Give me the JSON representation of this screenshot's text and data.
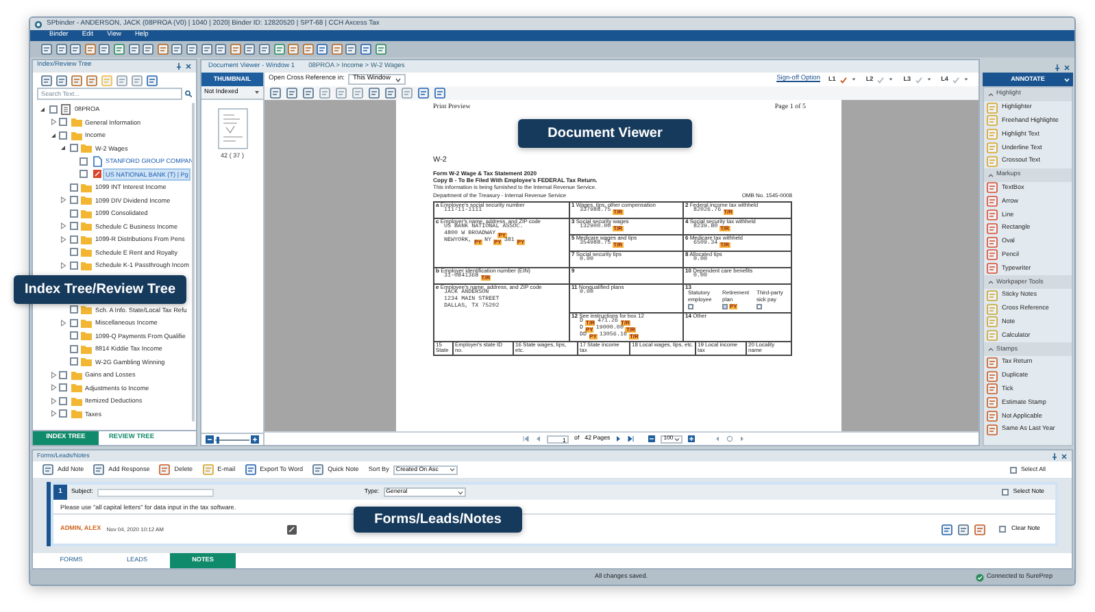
{
  "window": {
    "title": "SPbinder - ANDERSON, JACK (08PROA (V0) | 1040 | 2020| Binder ID: 12820520 | SPT-68 | CCH Axcess Tax"
  },
  "menu": [
    "Binder",
    "Edit",
    "View",
    "Help"
  ],
  "index_panel": {
    "title": "Index/Review Tree",
    "search": {
      "placeholder": "Search Text..."
    },
    "tree": [
      {
        "label": "08PROA",
        "kind": "binder",
        "expanded": true,
        "checked": false,
        "selected": false,
        "children": [
          {
            "label": "General Information",
            "kind": "folder",
            "expanded": false,
            "checked": false,
            "selected": false
          },
          {
            "label": "Income",
            "kind": "folder",
            "expanded": true,
            "checked": false,
            "selected": false,
            "children": [
              {
                "label": "W-2 Wages",
                "kind": "folder",
                "expanded": true,
                "checked": false,
                "selected": false,
                "children": [
                  {
                    "label": "STANFORD GROUP COMPAN",
                    "kind": "document",
                    "checked": false,
                    "selected": false
                  },
                  {
                    "label": "US NATIONAL BANK (T) | Pg",
                    "kind": "pdf",
                    "checked": false,
                    "selected": true
                  }
                ]
              },
              {
                "label": "1099 INT Interest Income",
                "kind": "folder",
                "checked": false,
                "selected": false
              },
              {
                "label": "1099 DIV Dividend Income",
                "kind": "folder",
                "expanded": false,
                "checked": false,
                "selected": false
              },
              {
                "label": "1099 Consolidated",
                "kind": "folder",
                "checked": false,
                "selected": false
              },
              {
                "label": "Schedule C Business Income",
                "kind": "folder",
                "expanded": false,
                "checked": false,
                "selected": false
              },
              {
                "label": "1099-R  Distributions From Pens",
                "kind": "folder",
                "expanded": false,
                "checked": false,
                "selected": false
              },
              {
                "label": "Schedule E  Rent and Royalty",
                "kind": "folder",
                "checked": false,
                "selected": false
              },
              {
                "label": "Schedule K-1 Passthrough Incom",
                "kind": "folder",
                "expanded": false,
                "checked": false,
                "selected": false
              },
              {
                "label": "Sch. A Info. State/Local Tax Refu",
                "kind": "folder",
                "checked": false,
                "selected": false
              },
              {
                "label": "Miscellaneous Income",
                "kind": "folder",
                "expanded": false,
                "checked": false,
                "selected": false
              },
              {
                "label": "1099-Q Payments From Qualifie",
                "kind": "folder",
                "checked": false,
                "selected": false
              },
              {
                "label": "8814 Kiddie Tax Income",
                "kind": "folder",
                "checked": false,
                "selected": false
              },
              {
                "label": "W-2G Gambling Winning",
                "kind": "folder",
                "checked": false,
                "selected": false
              }
            ]
          },
          {
            "label": "Gains and Losses",
            "kind": "folder",
            "expanded": false,
            "checked": false,
            "selected": false
          },
          {
            "label": "Adjustments to Income",
            "kind": "folder",
            "expanded": false,
            "checked": false,
            "selected": false
          },
          {
            "label": "Itemized Deductions",
            "kind": "folder",
            "expanded": false,
            "checked": false,
            "selected": false
          },
          {
            "label": "Taxes",
            "kind": "folder",
            "expanded": false,
            "checked": false,
            "selected": false
          }
        ]
      }
    ],
    "tabs": [
      {
        "label": "INDEX TREE",
        "selected": true
      },
      {
        "label": "REVIEW TREE",
        "selected": false
      }
    ]
  },
  "thumbnail_panel": {
    "tab": "THUMBNAIL",
    "filter": "Not Indexed",
    "caption": "42 ( 37 )",
    "zoom": {
      "level": 0.05
    }
  },
  "document_viewer": {
    "title": "Document Viewer - Window 1",
    "breadcrumb": "08PROA > Income > W-2 Wages",
    "cross_reference_label": "Open Cross Reference in:",
    "cross_reference_value": "This Window",
    "signoff_link": "Sign-off Option",
    "signoff_levels": [
      {
        "label": "L1",
        "checked": true
      },
      {
        "label": "L2",
        "checked": false
      },
      {
        "label": "L3",
        "checked": false
      },
      {
        "label": "L4",
        "checked": false
      }
    ],
    "page": {
      "header_left": "Print Preview",
      "header_right": "Page 1 of 5",
      "form_code": "W-2",
      "form_title": "Form W-2 Wage & Tax Statement 2020",
      "copy_line": "Copy B - To Be Filed With Employee's FEDERAL Tax Return.",
      "info_line": "This information is being furnished to the Internal Revenue Service.",
      "department": "Department of the Treasury - Internal Revenue Service",
      "omb": "OMB No. 1545-0008",
      "left_column": [
        {
          "label": "**a** Employee's social security number",
          "lines": [
            [
              {
                "kind": "text",
                "text": "111-11-1111"
              }
            ]
          ]
        },
        {
          "label": "**c** Employer's name, address, and ZIP code",
          "lines": [
            [
              {
                "kind": "text",
                "text": "US BANK NATIONAL ASSOC."
              }
            ],
            [
              {
                "kind": "text",
                "text": "4800 W BROADWAY"
              },
              {
                "kind": "tag",
                "text": "PY"
              }
            ],
            [
              {
                "kind": "text",
                "text": "NEWYORK,"
              },
              {
                "kind": "tag",
                "text": "PY"
              },
              {
                "kind": "text",
                "text": "NY"
              },
              {
                "kind": "tag",
                "text": "PY"
              },
              {
                "kind": "text",
                "text": "381"
              },
              {
                "kind": "tag",
                "text": "PY"
              }
            ]
          ]
        },
        {
          "label": "**b** Employer identification number (EIN)",
          "lines": [
            [
              {
                "kind": "text",
                "text": "31-0841368"
              },
              {
                "kind": "tag",
                "text": "T/R"
              }
            ]
          ]
        },
        {
          "label": "**e** Employee's name, address, and ZIP code",
          "lines": [
            [
              {
                "kind": "text",
                "text": "JACK ANDERSON"
              }
            ],
            [
              {
                "kind": "text",
                "text": "1234 MAIN STREET"
              }
            ],
            [
              {
                "kind": "text",
                "text": "DALLAS, TX 75202"
              }
            ]
          ]
        }
      ],
      "middle_column": [
        {
          "label": "**1** Wages, tips, other compensation",
          "lines": [
            [
              {
                "kind": "text",
                "text": "337988.75"
              },
              {
                "kind": "tag",
                "text": "T/R"
              }
            ]
          ]
        },
        {
          "label": "**3** Social security wages",
          "lines": [
            [
              {
                "kind": "text",
                "text": "132900.00"
              },
              {
                "kind": "tag",
                "text": "T/R"
              }
            ]
          ]
        },
        {
          "label": "**5** Medicare wages and tips",
          "lines": [
            [
              {
                "kind": "text",
                "text": "354988.75"
              },
              {
                "kind": "tag",
                "text": "T/R"
              }
            ]
          ]
        },
        {
          "label": "**7** Social security tips",
          "lines": [
            [
              {
                "kind": "text",
                "text": "0.00"
              }
            ]
          ]
        },
        {
          "label": "**9**"
        },
        {
          "label": "**11** Nonqualified plans",
          "lines": [
            [
              {
                "kind": "text",
                "text": "0.00"
              }
            ]
          ]
        },
        {
          "label": "**12** See instructions for box 12",
          "lines": [
            [
              {
                "kind": "text",
                "text": "D"
              },
              {
                "kind": "tag",
                "text": "T/R"
              },
              {
                "kind": "text",
                "text": "471.26"
              },
              {
                "kind": "tag",
                "text": "T/R"
              }
            ],
            [
              {
                "kind": "text",
                "text": "D"
              },
              {
                "kind": "tag",
                "text": "PY"
              },
              {
                "kind": "text",
                "text": "19000.00"
              },
              {
                "kind": "tag",
                "text": "T/R"
              }
            ],
            [
              {
                "kind": "text",
                "text": "DD"
              },
              {
                "kind": "tag",
                "text": "PY"
              },
              {
                "kind": "text",
                "text": "13056.16"
              },
              {
                "kind": "tag",
                "text": "T/R"
              }
            ]
          ]
        }
      ],
      "right_column": [
        {
          "label": "**2** Federal income tax withheld",
          "lines": [
            [
              {
                "kind": "text",
                "text": "82026.76"
              },
              {
                "kind": "tag",
                "text": "T/R"
              }
            ]
          ]
        },
        {
          "label": "**4** Social security tax withheld",
          "lines": [
            [
              {
                "kind": "text",
                "text": "8239.80"
              },
              {
                "kind": "tag",
                "text": "T/R"
              }
            ]
          ]
        },
        {
          "label": "**6** Medicare tax withheld",
          "lines": [
            [
              {
                "kind": "text",
                "text": "6509.34"
              },
              {
                "kind": "tag",
                "text": "T/R"
              }
            ]
          ]
        },
        {
          "label": "**8** Allocated tips",
          "lines": [
            [
              {
                "kind": "text",
                "text": "0.00"
              }
            ]
          ]
        },
        {
          "label": "**10** Dependent care benefits",
          "lines": [
            [
              {
                "kind": "text",
                "text": "0.00"
              }
            ]
          ]
        },
        {
          "label": "**13**",
          "checks": [
            {
              "label": "Statutory employee",
              "checked": false
            },
            {
              "label": "Retirement plan",
              "checked": true,
              "tag": "PY"
            },
            {
              "label": "Third-party sick pay",
              "checked": false
            }
          ]
        },
        {
          "label": "**14** Other"
        }
      ],
      "state_row": [
        "15  State",
        "Employer's state ID no.",
        "16 State wages, tips, etc.",
        "17 State income tax",
        "18 Local wages, tips, etc.",
        "19 Local income tax",
        "20 Locality name"
      ]
    },
    "pager": {
      "page": "1",
      "of_label": "of",
      "total": "42 Pages",
      "zoom": "100"
    }
  },
  "annotate_panel": {
    "title": "ANNOTATE",
    "sections": [
      {
        "title": "Highlight",
        "items": [
          "Highlighter",
          "Freehand Highlighte",
          "Highlight Text",
          "Underline Text",
          "Crossout Text"
        ]
      },
      {
        "title": "Markups",
        "items": [
          "TextBox",
          "Arrow",
          "Line",
          "Rectangle",
          "Oval",
          "Pencil",
          "Typewriter"
        ]
      },
      {
        "title": "Workpaper Tools",
        "items": [
          "Sticky Notes",
          "Cross Reference",
          "Note",
          "Calculator"
        ]
      },
      {
        "title": "Stamps",
        "items": [
          "Tax Return",
          "Duplicate",
          "Tick",
          "Estimate Stamp",
          "Not Applicable",
          "Same As Last Year"
        ]
      }
    ]
  },
  "notes_panel": {
    "title": "Forms/Leads/Notes",
    "toolbar": [
      "Add Note",
      "Add Response",
      "Delete",
      "E-mail",
      "Export To Word",
      "Quick Note"
    ],
    "sort_label": "Sort By",
    "sort_value": "Created On Asc",
    "select_all": {
      "label": "Select All",
      "checked": false
    },
    "notes": [
      {
        "number": "1",
        "subject_label": "Subject:",
        "type_label": "Type:",
        "type_value": "General",
        "select": {
          "label": "Select Note",
          "checked": false
        },
        "text": "Please use \"all capital letters\" for data input in the tax software.",
        "author": "ADMIN, ALEX",
        "timestamp": "Nov 04, 2020 10:12 AM",
        "clear": {
          "label": "Clear Note",
          "checked": false
        }
      }
    ],
    "tabs": [
      {
        "label": "FORMS",
        "selected": false
      },
      {
        "label": "LEADS",
        "selected": false
      },
      {
        "label": "NOTES",
        "selected": true
      }
    ]
  },
  "status_bar": {
    "message": "All changes saved.",
    "connection": "Connected to SurePrep"
  },
  "callouts": [
    "Document Viewer",
    "Index Tree/Review Tree",
    "Forms/Leads/Notes"
  ]
}
